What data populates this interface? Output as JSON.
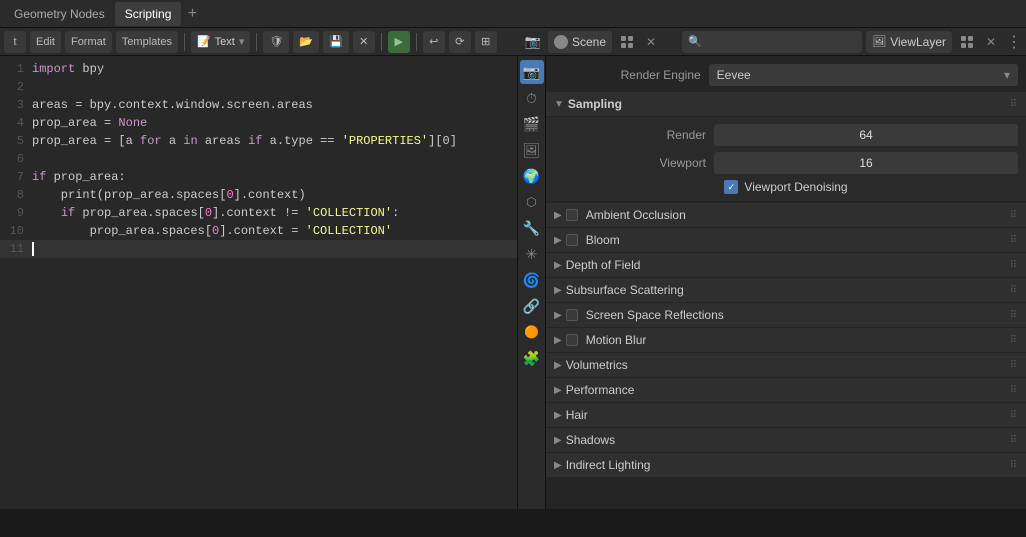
{
  "tabs": [
    {
      "label": "Geometry Nodes",
      "active": false
    },
    {
      "label": "Scripting",
      "active": true
    }
  ],
  "tab_add": "+",
  "toolbar": {
    "menu_items": [
      "t",
      "Edit",
      "Format",
      "Templates"
    ],
    "file_icon": "📄",
    "file_type": "Text",
    "shield_icon": "🛡",
    "open_icon": "📂",
    "save_icon": "💾",
    "close_icon": "✕",
    "run_icon": "▶",
    "wrap_icon": "↩",
    "sync_icon": "⟳",
    "tabs_icon": "⊞"
  },
  "code_lines": [
    {
      "num": "1",
      "content": "import bpy",
      "type": "import"
    },
    {
      "num": "2",
      "content": "",
      "type": "empty"
    },
    {
      "num": "3",
      "content": "areas = bpy.context.window.screen.areas",
      "type": "normal"
    },
    {
      "num": "4",
      "content": "prop_area = None",
      "type": "none_assign"
    },
    {
      "num": "5",
      "content": "prop_area = [a for a in areas if a.type == 'PROPERTIES'][0]",
      "type": "comprehension"
    },
    {
      "num": "6",
      "content": "",
      "type": "empty"
    },
    {
      "num": "7",
      "content": "if prop_area:",
      "type": "if"
    },
    {
      "num": "8",
      "content": "    print(prop_area.spaces[0].context)",
      "type": "print"
    },
    {
      "num": "9",
      "content": "    if prop_area.spaces[0].context != 'COLLECTION':",
      "type": "if_nested"
    },
    {
      "num": "10",
      "content": "        prop_area.spaces[0].context = 'COLLECTION'",
      "type": "assign"
    },
    {
      "num": "11",
      "content": "",
      "type": "cursor"
    }
  ],
  "right_panel": {
    "header": {
      "scene_label": "Scene",
      "search_placeholder": "",
      "view_layer": "ViewLayer",
      "scene_name": "Scene"
    },
    "render_engine": {
      "label": "Render Engine",
      "value": "Eevee"
    },
    "sampling": {
      "title": "Sampling",
      "render_label": "Render",
      "render_value": "64",
      "viewport_label": "Viewport",
      "viewport_value": "16",
      "denoising_label": "Viewport Denoising",
      "denoising_checked": true
    },
    "sections": [
      {
        "label": "Ambient Occlusion",
        "has_checkbox": true,
        "checked": false
      },
      {
        "label": "Bloom",
        "has_checkbox": true,
        "checked": false
      },
      {
        "label": "Depth of Field",
        "has_checkbox": false
      },
      {
        "label": "Subsurface Scattering",
        "has_checkbox": false
      },
      {
        "label": "Screen Space Reflections",
        "has_checkbox": true,
        "checked": false
      },
      {
        "label": "Motion Blur",
        "has_checkbox": true,
        "checked": false
      },
      {
        "label": "Volumetrics",
        "has_checkbox": false
      },
      {
        "label": "Performance",
        "has_checkbox": false
      },
      {
        "label": "Hair",
        "has_checkbox": false
      },
      {
        "label": "Shadows",
        "has_checkbox": false
      },
      {
        "label": "Indirect Lighting",
        "has_checkbox": false
      }
    ]
  },
  "side_icons": [
    {
      "icon": "📷",
      "label": "render",
      "active": true
    },
    {
      "icon": "⏱",
      "label": "output"
    },
    {
      "icon": "🎬",
      "label": "view-layer"
    },
    {
      "icon": "🖼",
      "label": "scene"
    },
    {
      "icon": "🌍",
      "label": "world"
    },
    {
      "icon": "🎲",
      "label": "object"
    },
    {
      "icon": "✏",
      "label": "modifiers"
    },
    {
      "icon": "🔧",
      "label": "particles"
    },
    {
      "icon": "🌀",
      "label": "physics"
    },
    {
      "icon": "🔗",
      "label": "constraints"
    },
    {
      "icon": "🟠",
      "label": "data"
    },
    {
      "icon": "🧩",
      "label": "material"
    }
  ]
}
